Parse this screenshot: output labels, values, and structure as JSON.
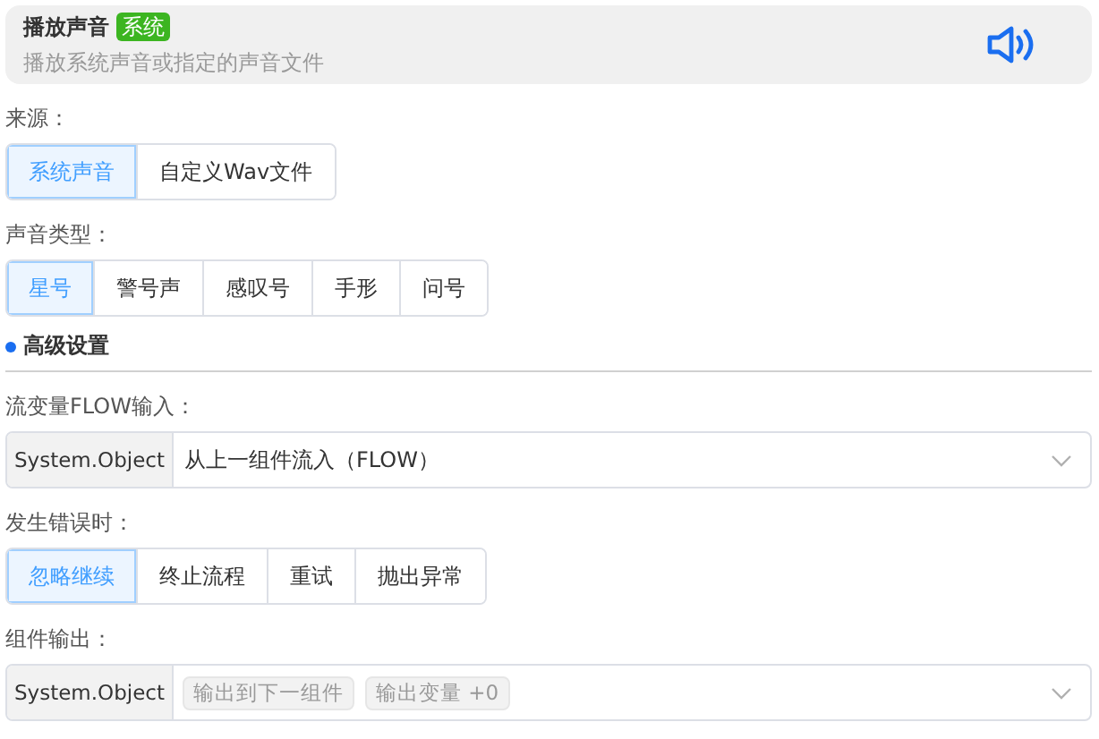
{
  "header": {
    "title": "播放声音",
    "badge": "系统",
    "description": "播放系统声音或指定的声音文件"
  },
  "source": {
    "label": "来源：",
    "options": [
      {
        "label": "系统声音",
        "selected": true
      },
      {
        "label": "自定义Wav文件",
        "selected": false
      }
    ]
  },
  "sound_type": {
    "label": "声音类型：",
    "options": [
      {
        "label": "星号",
        "selected": true
      },
      {
        "label": "警号声",
        "selected": false
      },
      {
        "label": "感叹号",
        "selected": false
      },
      {
        "label": "手形",
        "selected": false
      },
      {
        "label": "问号",
        "selected": false
      }
    ]
  },
  "section": {
    "title": "高级设置"
  },
  "flow_input": {
    "label": "流变量FLOW输入：",
    "type": "System.Object",
    "value": "从上一组件流入（FLOW）"
  },
  "on_error": {
    "label": "发生错误时：",
    "options": [
      {
        "label": "忽略继续",
        "selected": true
      },
      {
        "label": "终止流程",
        "selected": false
      },
      {
        "label": "重试",
        "selected": false
      },
      {
        "label": "抛出异常",
        "selected": false
      }
    ]
  },
  "output": {
    "label": "组件输出：",
    "type": "System.Object",
    "tags": [
      "输出到下一组件",
      "输出变量 +0"
    ]
  }
}
